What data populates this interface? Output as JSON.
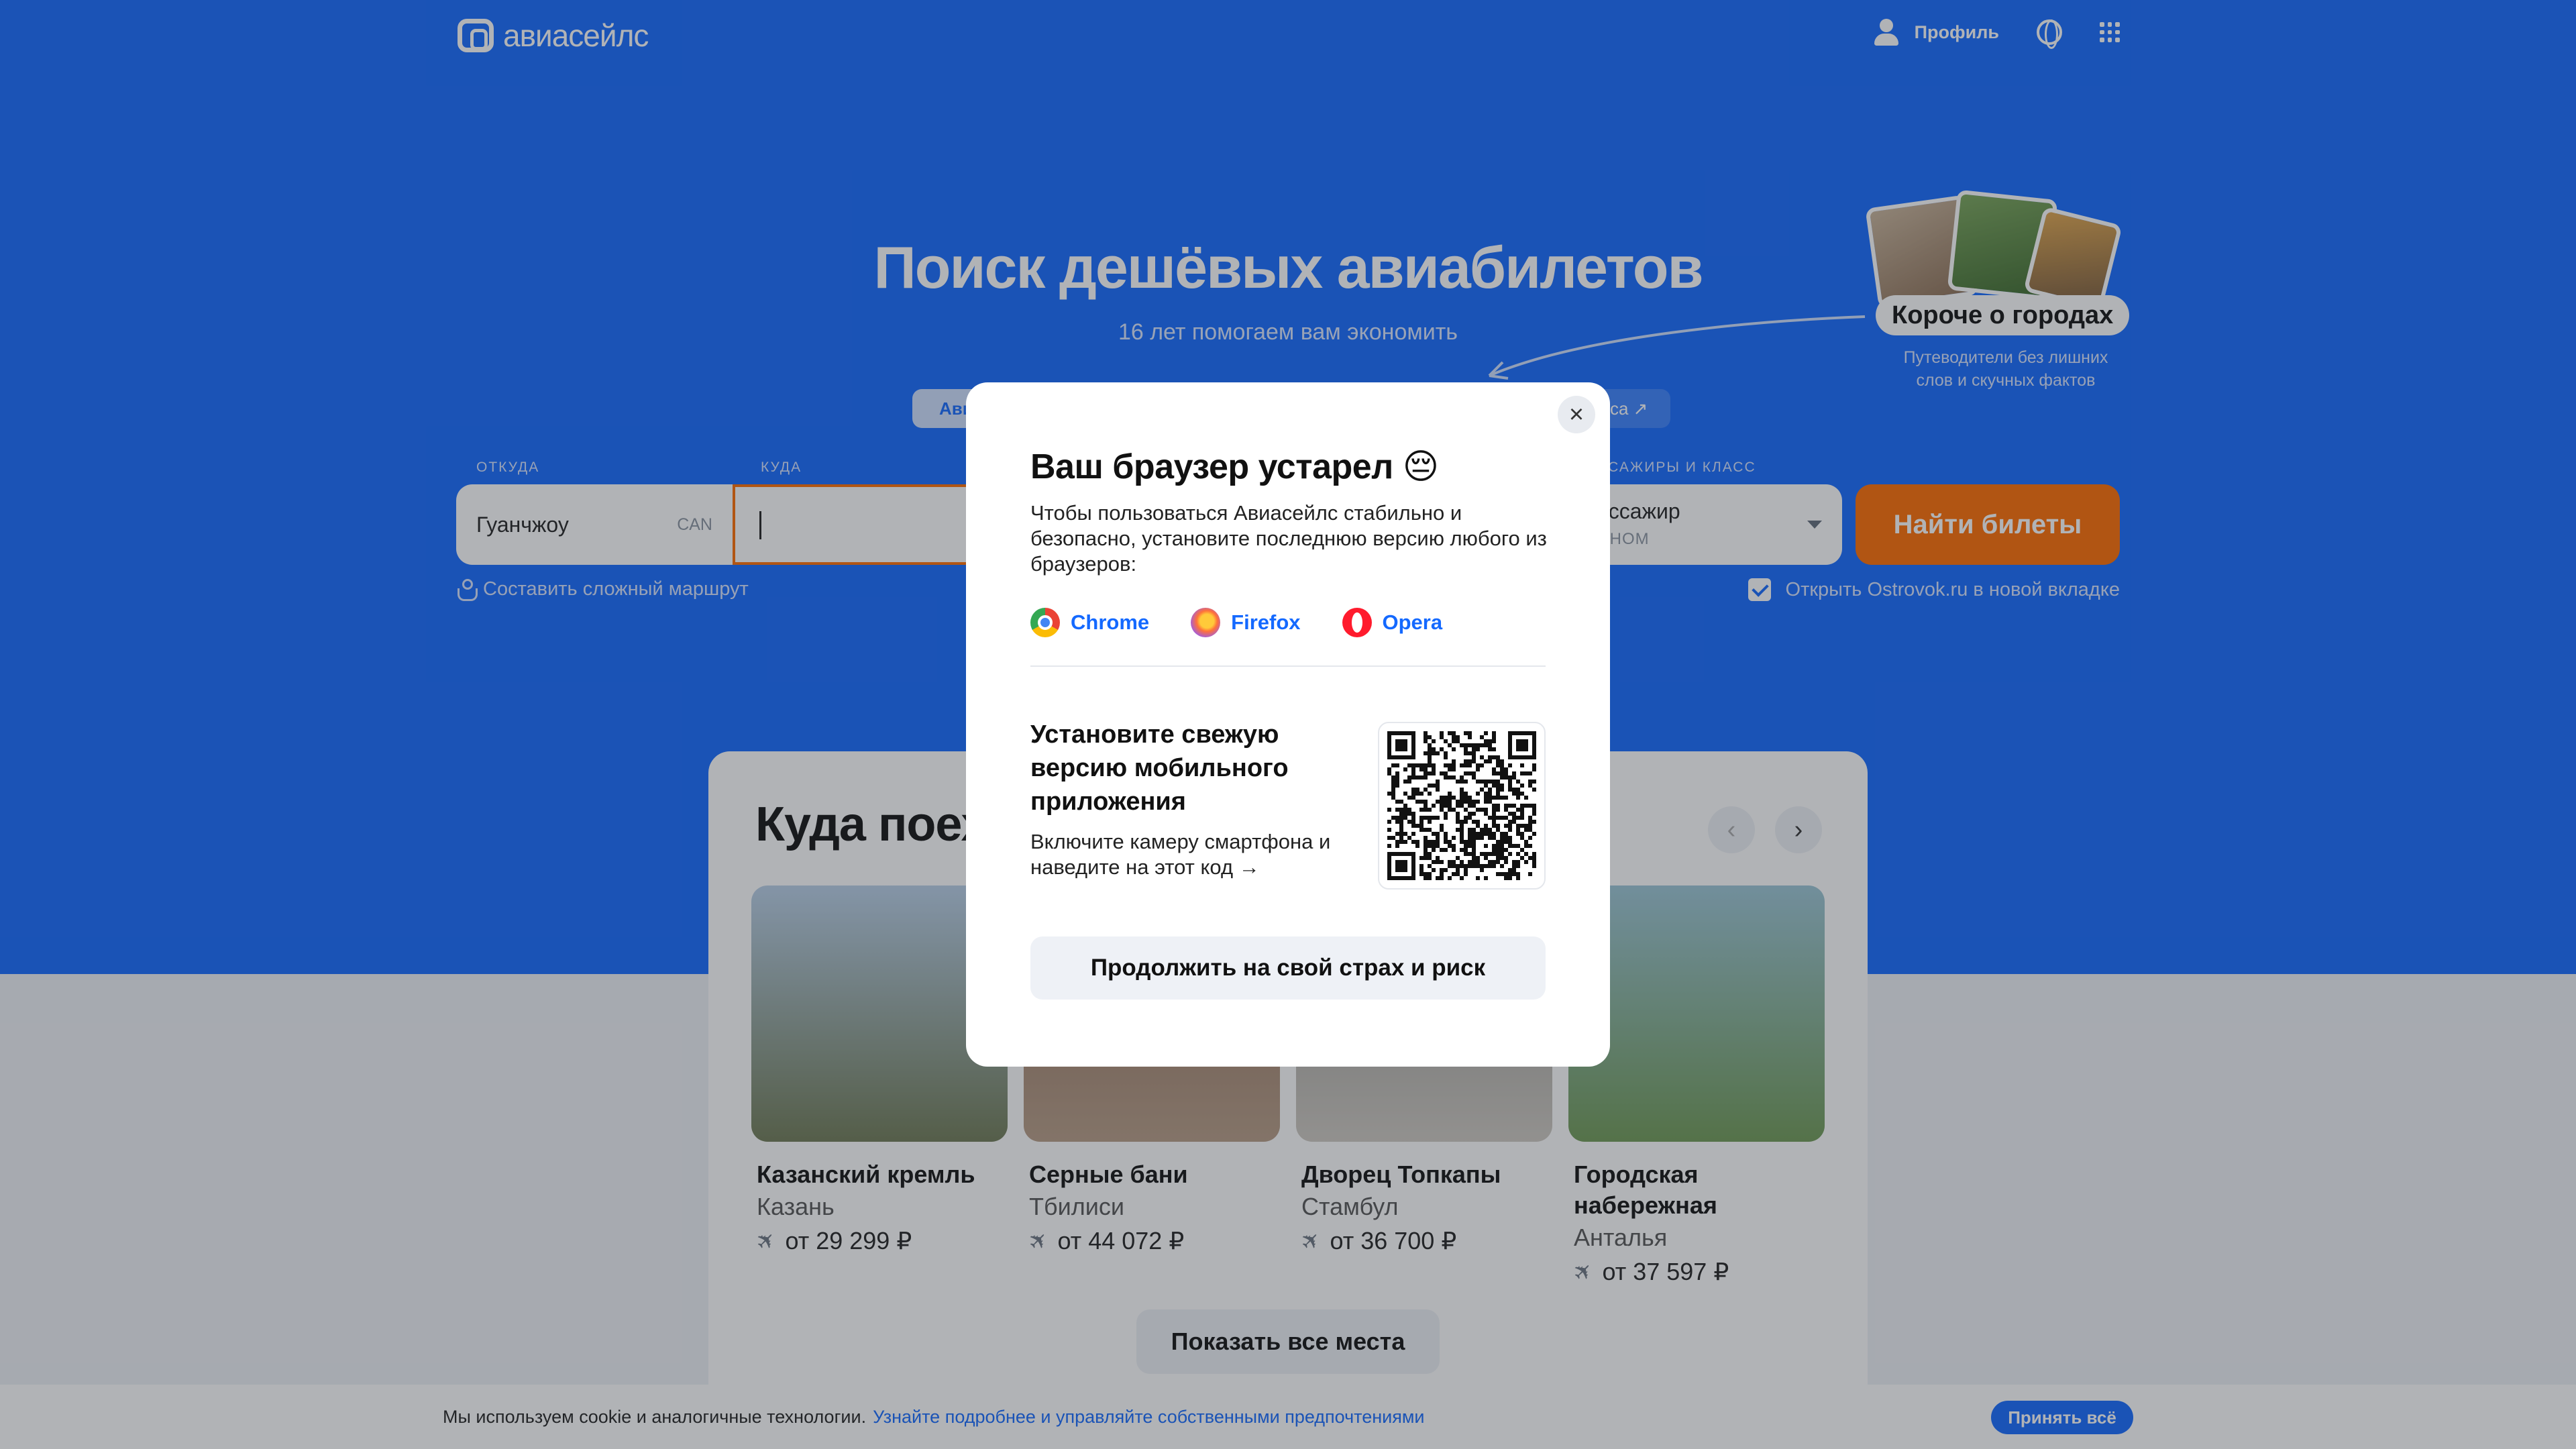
{
  "header": {
    "logo_text": "авиасейлс",
    "profile_label": "Профиль",
    "icons": [
      "profile-icon",
      "globe-icon",
      "apps-grid-icon"
    ]
  },
  "hero": {
    "title": "Поиск дешёвых авиабилетов",
    "subtitle": "16 лет помогаем вам экономить",
    "tab_left": "Ави",
    "tab_right": "са ↗"
  },
  "search": {
    "from_label": "ОТКУДА",
    "from_value": "Гуанчжоу",
    "from_code": "CAN",
    "to_label": "КУДА",
    "to_value": "",
    "passengers_label": "ССАЖИРЫ И КЛАСС",
    "passengers_value": "ассажир",
    "class_value": "ОНОМ",
    "find_button": "Найти билеты",
    "complex_route": "Составить сложный маршрут",
    "ostrovok_checkbox": "Открыть Ostrovok.ru в новой вкладке",
    "ostrovok_checked": true
  },
  "promo": {
    "tag": "Короче о городах",
    "subtitle_line1": "Путеводители без лишних",
    "subtitle_line2": "слов и скучных фактов"
  },
  "places": {
    "title": "Куда поех",
    "show_all": "Показать все места",
    "cards": [
      {
        "name": "Казанский кремль",
        "city": "Казань",
        "price": "от 29 299 ₽",
        "color_top": "#b9d0e8",
        "color_bottom": "#6f7a55"
      },
      {
        "name": "Серные бани",
        "city": "Тбилиси",
        "price": "от 44 072 ₽",
        "color_top": "#8d6a55",
        "color_bottom": "#b89d86"
      },
      {
        "name": "Дворец Топкапы",
        "city": "Стамбул",
        "price": "от 36 700 ₽",
        "color_top": "#8f8f8c",
        "color_bottom": "#cfcac2"
      },
      {
        "name": "Городская набережная",
        "city": "Анталья",
        "price": "от 37 597 ₽",
        "color_top": "#9cc6d6",
        "color_bottom": "#6f9a55"
      }
    ]
  },
  "cookie": {
    "text": "Мы используем cookie и аналогичные технологии.",
    "link": "Узнайте подробнее и управляйте собственными предпочтениями",
    "accept": "Принять всё"
  },
  "modal": {
    "title": "Ваш браузер устарел 😔",
    "text": "Чтобы пользоваться Авиасейлс стабильно и безопасно, установите последнюю версию любого из браузеров:",
    "browsers": [
      {
        "label": "Chrome",
        "icon": "chrome-icon"
      },
      {
        "label": "Firefox",
        "icon": "firefox-icon"
      },
      {
        "label": "Opera",
        "icon": "opera-icon"
      }
    ],
    "app_title": "Установите свежую версию мобильного приложения",
    "app_text": "Включите камеру смартфона и наведите на этот код →",
    "continue_button": "Продолжить на свой страх и риск",
    "close_icon": "close-icon"
  },
  "colors": {
    "brand_blue": "#1469ff",
    "accent_orange": "#ff6d00"
  }
}
